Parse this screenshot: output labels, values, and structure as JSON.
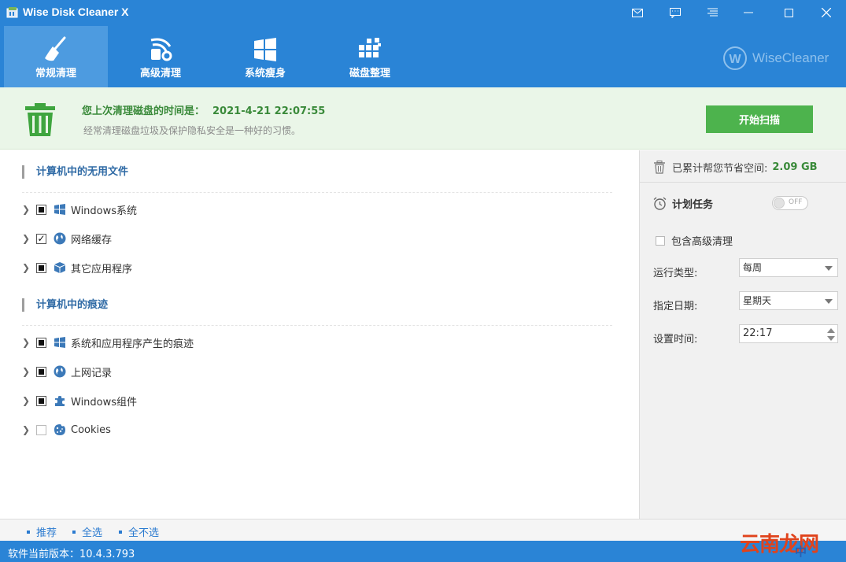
{
  "window": {
    "title": "Wise Disk Cleaner X"
  },
  "tabs": [
    {
      "label": "常规清理",
      "icon": "broom-icon",
      "active": true
    },
    {
      "label": "高级清理",
      "icon": "advanced-clean-icon",
      "active": false
    },
    {
      "label": "系统瘦身",
      "icon": "windows-slim-icon",
      "active": false
    },
    {
      "label": "磁盘整理",
      "icon": "defrag-icon",
      "active": false
    }
  ],
  "brand": {
    "logo_text": "WiseCleaner",
    "logo_mark": "W"
  },
  "banner": {
    "last_clean_label": "您上次清理磁盘的时间是：",
    "last_clean_datetime": "2021-4-21 22:07:55",
    "hint": "经常清理磁盘垃圾及保护隐私安全是一种好的习惯。",
    "scan_button": "开始扫描"
  },
  "sections": [
    {
      "title": "计算机中的无用文件",
      "items": [
        {
          "label": "Windows系统",
          "state": "partial",
          "icon": "windows-icon"
        },
        {
          "label": "网络缓存",
          "state": "checked",
          "icon": "globe-icon"
        },
        {
          "label": "其它应用程序",
          "state": "partial",
          "icon": "package-icon"
        }
      ]
    },
    {
      "title": "计算机中的痕迹",
      "items": [
        {
          "label": "系统和应用程序产生的痕迹",
          "state": "partial",
          "icon": "windows-icon"
        },
        {
          "label": "上网记录",
          "state": "partial",
          "icon": "globe-icon"
        },
        {
          "label": "Windows组件",
          "state": "partial",
          "icon": "puzzle-icon"
        },
        {
          "label": "Cookies",
          "state": "empty",
          "icon": "cookie-icon"
        }
      ]
    }
  ],
  "sidebar": {
    "saved_label": "已累计帮您节省空间:",
    "saved_value": "2.09 GB",
    "schedule_label": "计划任务",
    "toggle_text": "OFF",
    "include_advanced": "包含高级清理",
    "run_type_label": "运行类型:",
    "run_type_value": "每周",
    "date_label": "指定日期:",
    "date_value": "星期天",
    "time_label": "设置时间:",
    "time_value": "22:17"
  },
  "bottom": {
    "links": [
      "推荐",
      "全选",
      "全不选"
    ],
    "version": "软件当前版本：10.4.3.793"
  },
  "watermark": "云南龙网",
  "ime": "中",
  "colors": {
    "header": "#2a84d6",
    "active_tab": "#4d9be0",
    "green": "#4db34d",
    "banner": "#eaf6e8"
  }
}
